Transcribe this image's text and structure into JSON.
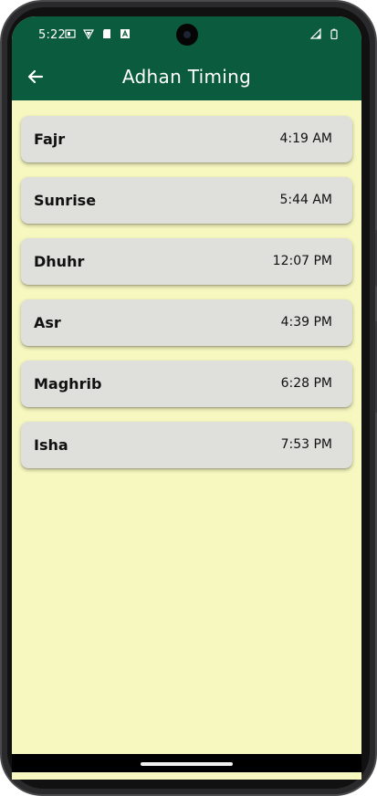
{
  "status_bar": {
    "time": "5:22",
    "left_icons": [
      "notification-icon",
      "shield-icon",
      "sd-card-icon",
      "a-icon"
    ],
    "right_icons": [
      "signal-icon",
      "battery-icon"
    ]
  },
  "app_bar": {
    "title": "Adhan Timing",
    "back_icon": "arrow-left-icon"
  },
  "prayers": [
    {
      "name": "Fajr",
      "time": "4:19 AM"
    },
    {
      "name": "Sunrise",
      "time": "5:44 AM"
    },
    {
      "name": "Dhuhr",
      "time": "12:07 PM"
    },
    {
      "name": "Asr",
      "time": "4:39 PM"
    },
    {
      "name": "Maghrib",
      "time": "6:28 PM"
    },
    {
      "name": "Isha",
      "time": "7:53 PM"
    }
  ],
  "colors": {
    "app_bar": "#0b5b3e",
    "background": "#f7f8c0",
    "card": "#dfdfdc"
  }
}
